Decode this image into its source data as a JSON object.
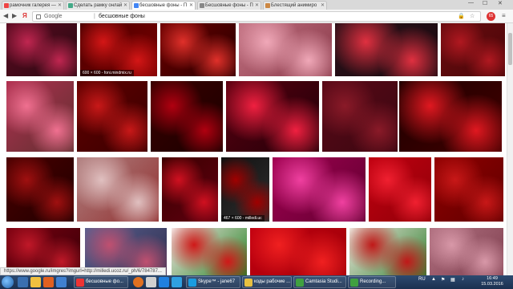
{
  "browser": {
    "tabs": [
      {
        "label": "рамочник галерея —",
        "color": "#e44"
      },
      {
        "label": "Сделать рамку онлай",
        "color": "#4a8"
      },
      {
        "label": "бесшовные фоны - П",
        "color": "#4285f4"
      },
      {
        "label": "Бесшовные фоны - П",
        "color": "#888"
      },
      {
        "label": "Блестящий анимиро",
        "color": "#c84"
      }
    ],
    "window_controls": {
      "minimize": "—",
      "maximize": "☐",
      "close": "✕"
    },
    "address": {
      "site": "Google",
      "query": "бесшовные фоны"
    },
    "profile_badge": "65"
  },
  "images": [
    {
      "id": "r1a",
      "colors": [
        "#5a0a20",
        "#c02650",
        "#2a0a12"
      ]
    },
    {
      "id": "r1b",
      "colors": [
        "#4a0000",
        "#d41616",
        "#7a0000"
      ],
      "caption": "600 × 600 - fonі.mindmix.ru"
    },
    {
      "id": "r1c",
      "colors": [
        "#6a0000",
        "#e0302a",
        "#2a0000"
      ]
    },
    {
      "id": "r1d",
      "colors": [
        "#c07080",
        "#f0a8b8",
        "#8a3a4a"
      ]
    },
    {
      "id": "r1e",
      "colors": [
        "#2a1018",
        "#e03040",
        "#1a0a10"
      ]
    },
    {
      "id": "r1f",
      "colors": [
        "#6a0c10",
        "#b01820",
        "#4a0608"
      ]
    },
    {
      "id": "r2a",
      "colors": [
        "#b03050",
        "#f07090",
        "#603030"
      ]
    },
    {
      "id": "r2b",
      "colors": [
        "#600000",
        "#c81818",
        "#3a0000"
      ]
    },
    {
      "id": "r2c",
      "colors": [
        "#3a0000",
        "#b00010",
        "#1a0000"
      ]
    },
    {
      "id": "r2d",
      "colors": [
        "#5a0010",
        "#f02040",
        "#200008"
      ]
    },
    {
      "id": "r2e",
      "colors": [
        "#5a0a18",
        "#8a1a28",
        "#3a0610"
      ]
    },
    {
      "id": "r2f",
      "colors": [
        "#200000",
        "#e01820",
        "#400000"
      ]
    },
    {
      "id": "r3a",
      "colors": [
        "#4a0000",
        "#a01010",
        "#200000"
      ]
    },
    {
      "id": "r3b",
      "colors": [
        "#b08080",
        "#e0c0c0",
        "#903030"
      ]
    },
    {
      "id": "r3c",
      "colors": [
        "#3a0000",
        "#d01020",
        "#600010"
      ]
    },
    {
      "id": "r3d",
      "colors": [
        "#101010",
        "#a00000",
        "#303030"
      ],
      "caption": "467 × 600 - milledi.uc"
    },
    {
      "id": "r3e",
      "colors": [
        "#a00050",
        "#f040a0",
        "#600030"
      ]
    },
    {
      "id": "r3f",
      "colors": [
        "#c00010",
        "#f02030",
        "#900008"
      ]
    },
    {
      "id": "r3g",
      "colors": [
        "#900000",
        "#c81818",
        "#600000"
      ]
    },
    {
      "id": "r4a",
      "colors": [
        "#7a0010",
        "#c01828",
        "#3a0008"
      ]
    },
    {
      "id": "r4b",
      "colors": [
        "#5a6090",
        "#c05070",
        "#303050"
      ]
    },
    {
      "id": "r4c",
      "colors": [
        "#f8e8e8",
        "#d01818",
        "#208020"
      ]
    },
    {
      "id": "r4d",
      "colors": [
        "#c00010",
        "#f02020",
        "#a00008"
      ]
    },
    {
      "id": "r4e",
      "colors": [
        "#f0e8e0",
        "#c01818",
        "#308030"
      ]
    },
    {
      "id": "r4f",
      "colors": [
        "#b07080",
        "#d898a8",
        "#804050"
      ]
    }
  ],
  "status_url": "https://www.google.ru/imgres?imgurl=http://milledi.ucoz.ru/_ph/6/784787...",
  "taskbar": {
    "tasks": [
      {
        "label": "бесшовные фо...",
        "color": "#e33"
      },
      {
        "label": "Skype™ - jane67",
        "color": "#1a9ce0"
      },
      {
        "label": "коды рабочие ...",
        "color": "#e8c040"
      },
      {
        "label": "Camtasia Studi...",
        "color": "#40a040"
      },
      {
        "label": "Recording...",
        "color": "#40a040"
      }
    ],
    "lang": "RU",
    "time": "16:49",
    "date": "15.03.2016"
  }
}
